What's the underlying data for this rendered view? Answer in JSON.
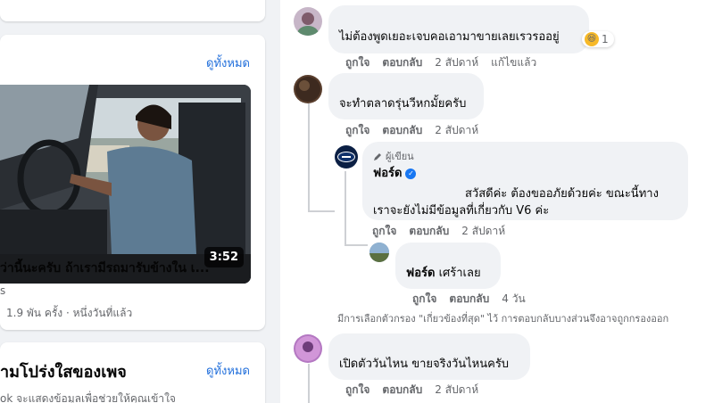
{
  "left": {
    "videos_see_all": "ดูทั้งหมด",
    "video": {
      "duration": "3:52",
      "title": "ว่านี้นะครับ ถ้าเรามีรถมารับข้างใน เ...",
      "subline": "s",
      "meta": "1.9 พัน ครั้ง · หนึ่งวันที่แล้ว"
    },
    "transparency": {
      "title": "ามโปร่งใสของเพจ",
      "see_all": "ดูทั้งหมด",
      "body": "ok จะแสดงข้อมูลเพื่อช่วยให้คุณเข้าใจ"
    }
  },
  "comments": [
    {
      "text": "ไม่ต้องพูดเยอะเจบคอเอามาขายเลยเรวรออยู่",
      "reaction_count": "1",
      "like": "ถูกใจ",
      "reply": "ตอบกลับ",
      "time": "2 สัปดาห์",
      "edited": "แก้ไขแล้ว"
    },
    {
      "text": "จะทำตลาดรุ่นวีหกมั้ยครับ",
      "like": "ถูกใจ",
      "reply": "ตอบกลับ",
      "time": "2 สัปดาห์"
    }
  ],
  "reply_author": {
    "badge": "ผู้เขียน",
    "name": "ฟอร์ด",
    "text_line1": "สวัสดีค่ะ ต้องขออภัยด้วยค่ะ ขณะนี้ทาง",
    "text_line2": "เราจะยังไม่มีข้อมูลที่เกี่ยวกับ V6 ค่ะ",
    "like": "ถูกใจ",
    "reply": "ตอบกลับ",
    "time": "2 สัปดาห์"
  },
  "reply2": {
    "name": "ฟอร์ด",
    "text": "เศร้าเลย",
    "like": "ถูกใจ",
    "reply": "ตอบกลับ",
    "time": "4 วัน"
  },
  "filter_note": "มีการเลือกตัวกรอง \"เกี่ยวข้องที่สุด\" ไว้ การตอบกลับบางส่วนจึงอาจถูกกรองออก",
  "comment3": {
    "text": "เปิดตัววันไหน ขายจริงวันไหนครับ",
    "like": "ถูกใจ",
    "reply": "ตอบกลับ",
    "time": "2 สัปดาห์"
  },
  "colors": {
    "link": "#216fdb",
    "bubble": "#f0f2f5",
    "verified": "#1877f2",
    "ford_blue": "#10316b"
  },
  "icons": [
    "pencil-icon",
    "verified-badge-icon",
    "laughing-emoji-icon",
    "ford-logo-icon"
  ]
}
